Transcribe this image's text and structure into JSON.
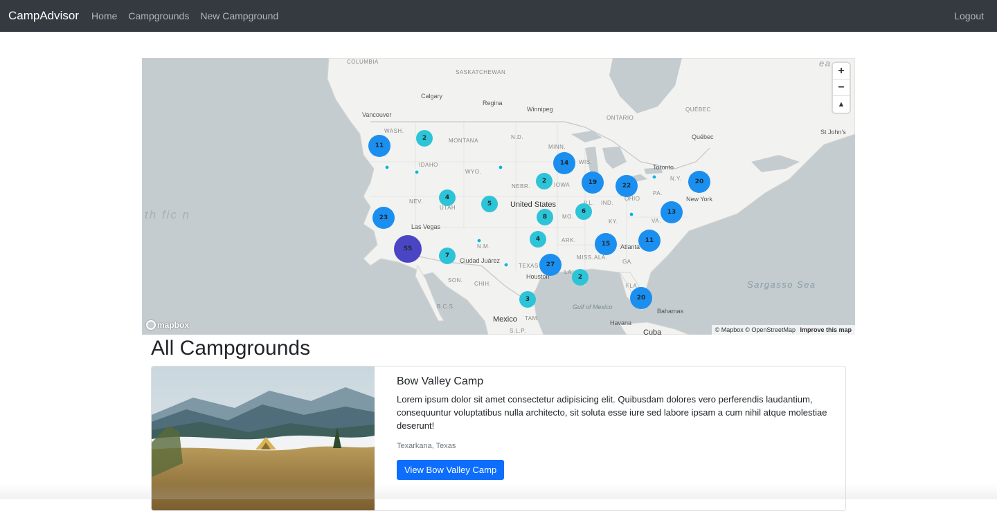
{
  "navbar": {
    "brand": "CampAdvisor",
    "links": [
      "Home",
      "Campgrounds",
      "New Campground"
    ],
    "logout": "Logout"
  },
  "map": {
    "places": {
      "columbia": "COLUMBIA",
      "saskatchewan": "SASKATCHEWAN",
      "calgary": "Calgary",
      "regina": "Regina",
      "winnipeg": "Winnipeg",
      "ontario": "ONTARIO",
      "quebec_prov": "QUÉBEC",
      "vancouver": "Vancouver",
      "wash": "WASH.",
      "montana": "MONTANA",
      "nd": "N.D.",
      "minn": "MINN.",
      "wis": "WIS.",
      "idaho": "IDAHO",
      "wyo": "WYO.",
      "nebr": "NEBR.",
      "iowa": "IOWA",
      "nev": "NEV.",
      "utah": "UTAH",
      "united_states": "United States",
      "ill": "ILL.",
      "ind": "IND.",
      "ohio": "OHIO",
      "pa": "PA.",
      "ny": "N.Y.",
      "toronto": "Toronto",
      "quebec_city": "Québec",
      "st_johns": "St John's",
      "new_york": "New York",
      "mo": "MO.",
      "ky": "KY.",
      "va": "VA.",
      "las_vegas": "Las Vegas",
      "nm": "N.M.",
      "ark": "ARK.",
      "miss": "MISS.",
      "ala": "ALA.",
      "ga": "GA.",
      "atlanta": "Atlanta",
      "ciudad_juarez": "Ciudad Juárez",
      "texas": "TEXAS",
      "la": "LA.",
      "houston": "Houston",
      "son": "SON.",
      "chih": "CHIH.",
      "fla": "FLA.",
      "bcs": "B.C.S.",
      "mexico": "Mexico",
      "tam": "TAM.",
      "slp": "S.L.P.",
      "gulf": "Gulf of Mexico",
      "bahamas": "Bahamas",
      "havana": "Havana",
      "cuba": "Cuba",
      "sargasso": "Sargasso Sea",
      "ocean_fragment": "th fic n",
      "ea": "ea"
    },
    "clusters": [
      "2",
      "11",
      "14",
      "2",
      "19",
      "22",
      "20",
      "4",
      "5",
      "6",
      "13",
      "23",
      "8",
      "4",
      "15",
      "11",
      "55",
      "7",
      "27",
      "2",
      "3",
      "20"
    ],
    "controls": {
      "zoom_in": "+",
      "zoom_out": "−",
      "compass": "▲"
    },
    "logo": "mapbox",
    "attribution": {
      "mapbox": "© Mapbox",
      "osm": "© OpenStreetMap",
      "improve": "Improve this map"
    },
    "colors": {
      "small": "#2dc4d8",
      "medium": "#1b8ff0",
      "large": "#4a45c2"
    }
  },
  "heading": "All Campgrounds",
  "campgrounds": [
    {
      "title": "Bow Valley Camp",
      "description": "Lorem ipsum dolor sit amet consectetur adipisicing elit. Quibusdam dolores vero perferendis laudantium, consequuntur voluptatibus nulla architecto, sit soluta esse iure sed labore ipsam a cum nihil atque molestiae deserunt!",
      "location": "Texarkana, Texas",
      "button": "View Bow Valley Camp"
    }
  ]
}
